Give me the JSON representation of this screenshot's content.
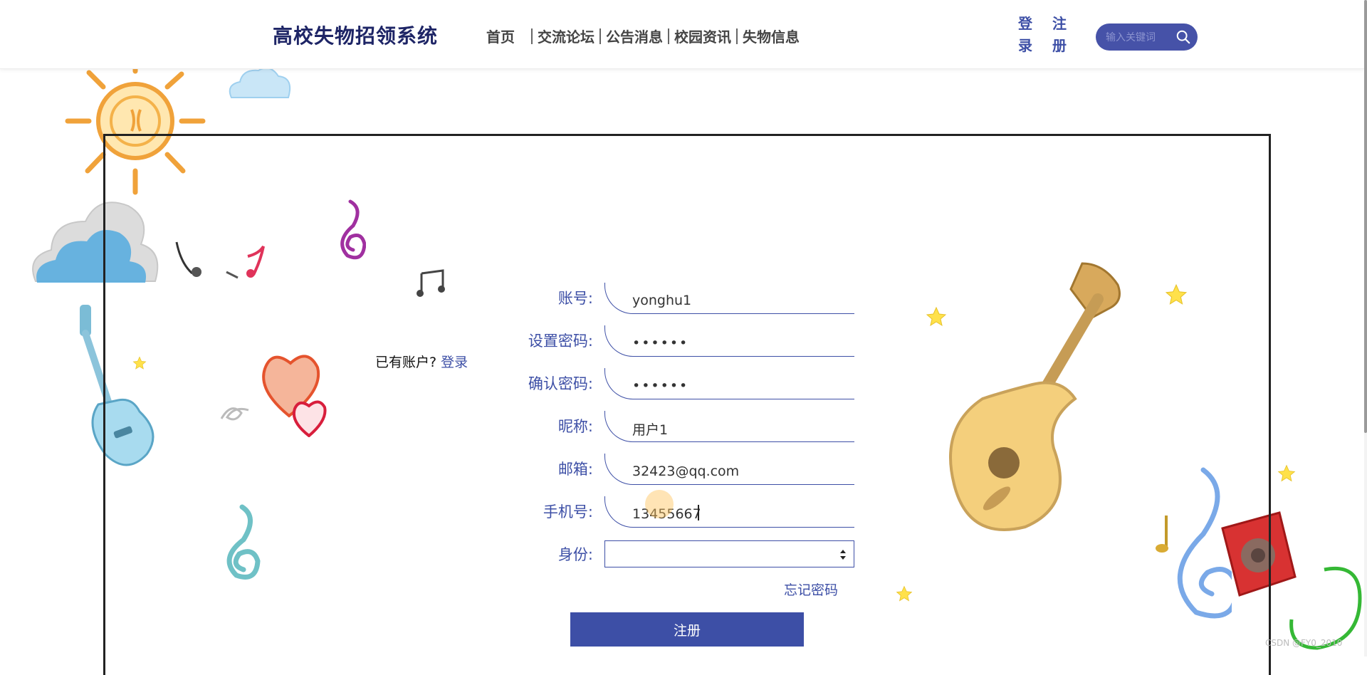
{
  "header": {
    "brand": "高校失物招领系统",
    "nav": [
      "首页",
      "交流论坛",
      "公告消息",
      "校园资讯",
      "失物信息"
    ],
    "login_chars": [
      "登",
      "录"
    ],
    "register_chars": [
      "注",
      "册"
    ],
    "search_placeholder": "输入关键词"
  },
  "side": {
    "have_account": "已有账户?",
    "login_link": "登录"
  },
  "form": {
    "fields": [
      {
        "label": "账号:",
        "value": "yonghu1",
        "type": "text"
      },
      {
        "label": "设置密码:",
        "value": "123456",
        "type": "password"
      },
      {
        "label": "确认密码:",
        "value": "123456",
        "type": "password"
      },
      {
        "label": "昵称:",
        "value": "用户1",
        "type": "text"
      },
      {
        "label": "邮箱:",
        "value": "32423@qq.com",
        "type": "text"
      },
      {
        "label": "手机号:",
        "value": "13455667",
        "type": "text"
      }
    ],
    "role_label": "身份:",
    "role_value": "",
    "forgot_password": "忘记密码",
    "submit": "注册"
  },
  "watermark": "CSDN @FY0_2010",
  "colors": {
    "accent": "#3d4fa6",
    "brand": "#1e2566",
    "search_bg": "#4652a8"
  }
}
